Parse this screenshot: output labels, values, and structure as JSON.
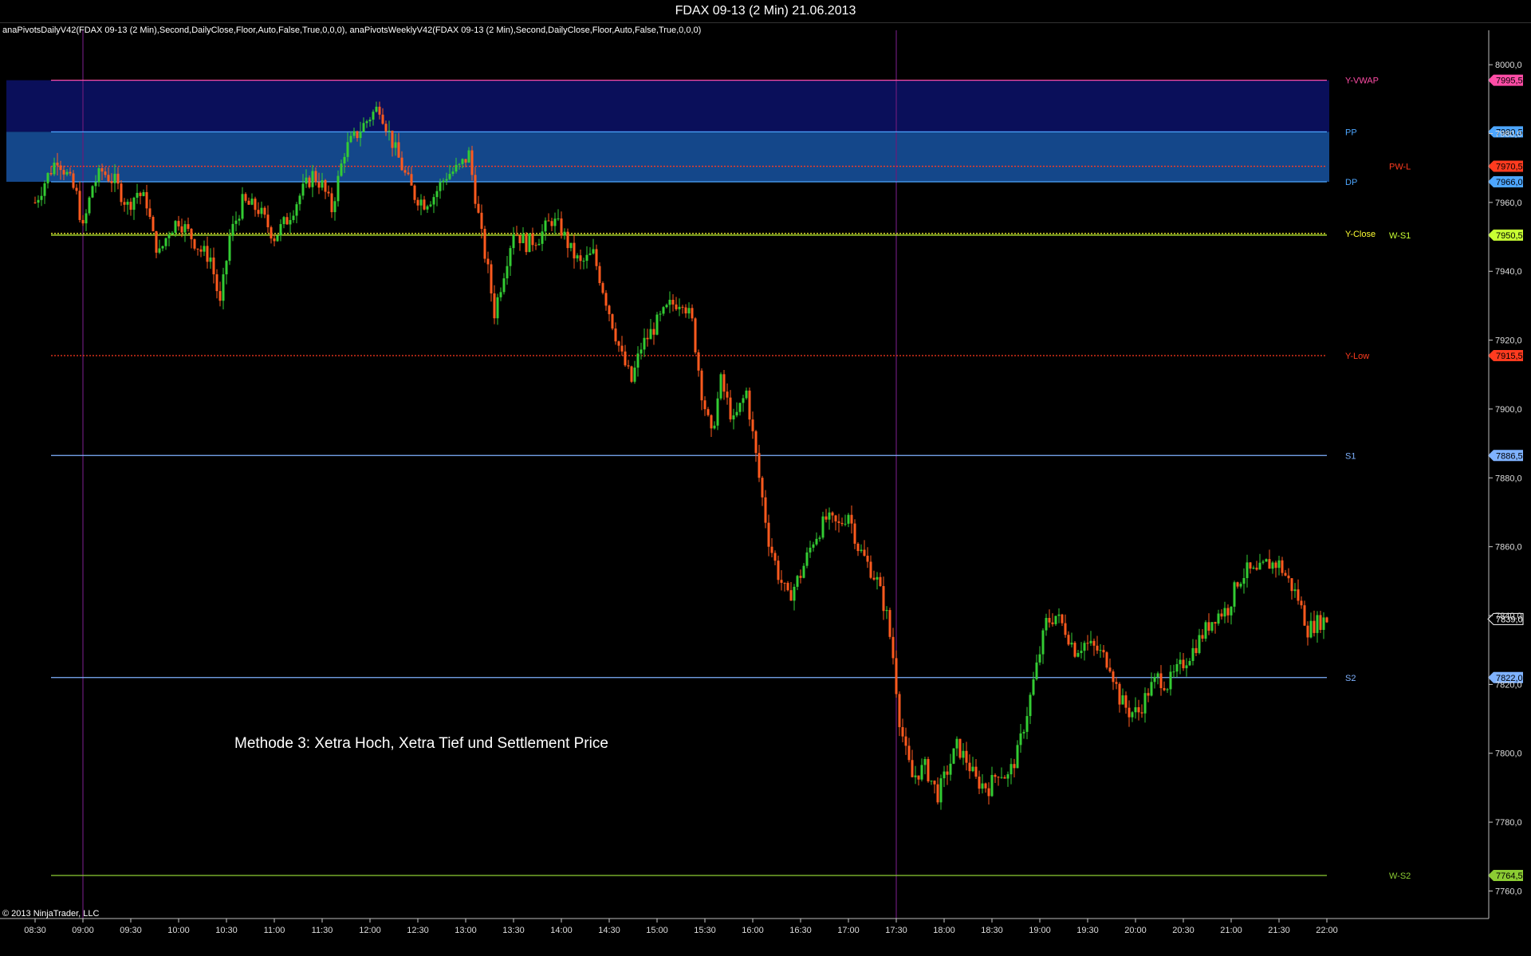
{
  "window_title": "FDAX 09-13 (2 Min)  21.06.2013",
  "indicator_text": "anaPivotsDailyV42(FDAX 09-13 (2 Min),Second,DailyClose,Floor,Auto,False,True,0,0,0), anaPivotsWeeklyV42(FDAX 09-13 (2 Min),Second,DailyClose,Floor,Auto,False,True,0,0,0)",
  "copyright": "© 2013 NinjaTrader, LLC",
  "annotation": "Methode 3: Xetra Hoch, Xetra Tief und Settlement Price",
  "colors": {
    "background": "#000000",
    "up_candle": "#33cc33",
    "down_candle": "#ff5a1e",
    "zone_dark": "#0a0f5a",
    "zone_light": "#14478a",
    "session_line": "#6a1a7a",
    "axis": "#cccccc"
  },
  "chart_data": {
    "type": "candlestick",
    "title": "FDAX 09-13 (2 Min)  21.06.2013",
    "ylim": [
      7752,
      8010
    ],
    "y_ticks": [
      7760,
      7780,
      7800,
      7820,
      7840,
      7860,
      7880,
      7900,
      7920,
      7940,
      7960,
      7980,
      8000
    ],
    "y_tick_labels": [
      "7760,0",
      "7780,0",
      "7800,0",
      "7820,0",
      "7840,0",
      "7860,0",
      "7880,0",
      "7900,0",
      "7920,0",
      "7940,0",
      "7960,0",
      "7980,0",
      "8000,0"
    ],
    "x_ticks": [
      "08:30",
      "09:00",
      "09:30",
      "10:00",
      "10:30",
      "11:00",
      "11:30",
      "12:00",
      "12:30",
      "13:00",
      "13:30",
      "14:00",
      "14:30",
      "15:00",
      "15:30",
      "16:00",
      "16:30",
      "17:00",
      "17:30",
      "18:00",
      "18:30",
      "19:00",
      "19:30",
      "20:00",
      "20:30",
      "21:00",
      "21:30",
      "22:00"
    ],
    "x_start_minutes": 510,
    "x_end_minutes": 1320,
    "session_markers": [
      "09:00",
      "17:30"
    ],
    "zones": [
      {
        "from": 7980.5,
        "to": 7995.5,
        "color": "#0a0f5a"
      },
      {
        "from": 7966.0,
        "to": 7980.5,
        "color": "#14478a"
      }
    ],
    "levels": [
      {
        "label": "Y-VWAP",
        "value": 7995.5,
        "color": "#ff4da6",
        "style": "solid",
        "tag": "7995,5",
        "label_col": "left"
      },
      {
        "label": "PP",
        "value": 7980.5,
        "color": "#4da6ff",
        "style": "solid",
        "tag": "7980,5",
        "label_col": "left"
      },
      {
        "label": "PW-L",
        "value": 7970.5,
        "color": "#ff3b1f",
        "style": "dotted",
        "tag": "7970,5",
        "label_col": "right"
      },
      {
        "label": "DP",
        "value": 7966.0,
        "color": "#4da6ff",
        "style": "solid",
        "tag": "7966,0",
        "label_col": "left"
      },
      {
        "label": "Y-Close",
        "value": 7951.0,
        "color": "#ffff33",
        "style": "dotted",
        "tag": "",
        "label_col": "left"
      },
      {
        "label": "W-S1",
        "value": 7950.5,
        "color": "#c8ff33",
        "style": "solid",
        "tag": "7950,5",
        "label_col": "right"
      },
      {
        "label": "Y-Low",
        "value": 7915.5,
        "color": "#ff3b1f",
        "style": "dotted",
        "tag": "7915,5",
        "label_col": "left"
      },
      {
        "label": "S1",
        "value": 7886.5,
        "color": "#7fb2ff",
        "style": "solid",
        "tag": "7886,5",
        "label_col": "left"
      },
      {
        "label": "S2",
        "value": 7822.0,
        "color": "#7fb2ff",
        "style": "solid",
        "tag": "7822,0",
        "label_col": "left"
      },
      {
        "label": "W-S2",
        "value": 7764.5,
        "color": "#8ccc33",
        "style": "solid",
        "tag": "7764,5",
        "label_col": "right"
      }
    ],
    "last_price": {
      "value": 7839.0,
      "tag": "7839,0"
    },
    "price_path": [
      [
        "08:30",
        7960
      ],
      [
        "08:36",
        7966
      ],
      [
        "08:44",
        7973
      ],
      [
        "08:50",
        7968
      ],
      [
        "08:56",
        7962
      ],
      [
        "09:00",
        7952
      ],
      [
        "09:06",
        7965
      ],
      [
        "09:12",
        7969
      ],
      [
        "09:20",
        7966
      ],
      [
        "09:28",
        7959
      ],
      [
        "09:34",
        7963
      ],
      [
        "09:40",
        7960
      ],
      [
        "09:44",
        7950
      ],
      [
        "09:48",
        7945
      ],
      [
        "09:54",
        7952
      ],
      [
        "10:00",
        7955
      ],
      [
        "10:08",
        7950
      ],
      [
        "10:14",
        7946
      ],
      [
        "10:20",
        7944
      ],
      [
        "10:26",
        7930
      ],
      [
        "10:32",
        7950
      ],
      [
        "10:40",
        7960
      ],
      [
        "10:50",
        7958
      ],
      [
        "11:00",
        7950
      ],
      [
        "11:08",
        7955
      ],
      [
        "11:16",
        7962
      ],
      [
        "11:24",
        7968
      ],
      [
        "11:30",
        7965
      ],
      [
        "11:36",
        7958
      ],
      [
        "11:44",
        7975
      ],
      [
        "11:52",
        7980
      ],
      [
        "12:00",
        7985
      ],
      [
        "12:06",
        7988
      ],
      [
        "12:12",
        7980
      ],
      [
        "12:16",
        7975
      ],
      [
        "12:22",
        7968
      ],
      [
        "12:28",
        7962
      ],
      [
        "12:34",
        7960
      ],
      [
        "12:40",
        7962
      ],
      [
        "12:48",
        7968
      ],
      [
        "12:56",
        7970
      ],
      [
        "13:02",
        7974
      ],
      [
        "13:06",
        7962
      ],
      [
        "13:10",
        7950
      ],
      [
        "13:14",
        7940
      ],
      [
        "13:18",
        7928
      ],
      [
        "13:24",
        7940
      ],
      [
        "13:30",
        7952
      ],
      [
        "13:38",
        7948
      ],
      [
        "13:46",
        7950
      ],
      [
        "13:54",
        7955
      ],
      [
        "14:00",
        7952
      ],
      [
        "14:06",
        7946
      ],
      [
        "14:12",
        7942
      ],
      [
        "14:20",
        7945
      ],
      [
        "14:26",
        7935
      ],
      [
        "14:32",
        7925
      ],
      [
        "14:38",
        7915
      ],
      [
        "14:44",
        7908
      ],
      [
        "14:50",
        7918
      ],
      [
        "15:00",
        7925
      ],
      [
        "15:08",
        7930
      ],
      [
        "15:16",
        7932
      ],
      [
        "15:22",
        7925
      ],
      [
        "15:28",
        7905
      ],
      [
        "15:34",
        7892
      ],
      [
        "15:40",
        7908
      ],
      [
        "15:48",
        7896
      ],
      [
        "15:56",
        7905
      ],
      [
        "16:04",
        7880
      ],
      [
        "16:10",
        7862
      ],
      [
        "16:16",
        7852
      ],
      [
        "16:22",
        7845
      ],
      [
        "16:30",
        7852
      ],
      [
        "16:38",
        7862
      ],
      [
        "16:46",
        7868
      ],
      [
        "16:54",
        7866
      ],
      [
        "17:00",
        7870
      ],
      [
        "17:06",
        7860
      ],
      [
        "17:12",
        7855
      ],
      [
        "17:18",
        7850
      ],
      [
        "17:24",
        7840
      ],
      [
        "17:28",
        7828
      ],
      [
        "17:32",
        7810
      ],
      [
        "17:36",
        7800
      ],
      [
        "17:40",
        7793
      ],
      [
        "17:48",
        7796
      ],
      [
        "17:56",
        7788
      ],
      [
        "18:02",
        7795
      ],
      [
        "18:08",
        7802
      ],
      [
        "18:14",
        7798
      ],
      [
        "18:20",
        7792
      ],
      [
        "18:28",
        7790
      ],
      [
        "18:34",
        7795
      ],
      [
        "18:40",
        7793
      ],
      [
        "18:46",
        7800
      ],
      [
        "18:52",
        7812
      ],
      [
        "18:58",
        7825
      ],
      [
        "19:04",
        7838
      ],
      [
        "19:10",
        7840
      ],
      [
        "19:16",
        7836
      ],
      [
        "19:22",
        7830
      ],
      [
        "19:28",
        7832
      ],
      [
        "19:36",
        7830
      ],
      [
        "19:44",
        7826
      ],
      [
        "19:50",
        7816
      ],
      [
        "19:56",
        7812
      ],
      [
        "20:02",
        7812
      ],
      [
        "20:08",
        7818
      ],
      [
        "20:14",
        7822
      ],
      [
        "20:20",
        7820
      ],
      [
        "20:28",
        7825
      ],
      [
        "20:36",
        7830
      ],
      [
        "20:44",
        7836
      ],
      [
        "20:50",
        7840
      ],
      [
        "20:58",
        7842
      ],
      [
        "21:04",
        7850
      ],
      [
        "21:10",
        7853
      ],
      [
        "21:16",
        7852
      ],
      [
        "21:22",
        7855
      ],
      [
        "21:30",
        7855
      ],
      [
        "21:36",
        7850
      ],
      [
        "21:42",
        7845
      ],
      [
        "21:48",
        7836
      ],
      [
        "21:54",
        7838
      ],
      [
        "22:00",
        7839
      ]
    ]
  }
}
